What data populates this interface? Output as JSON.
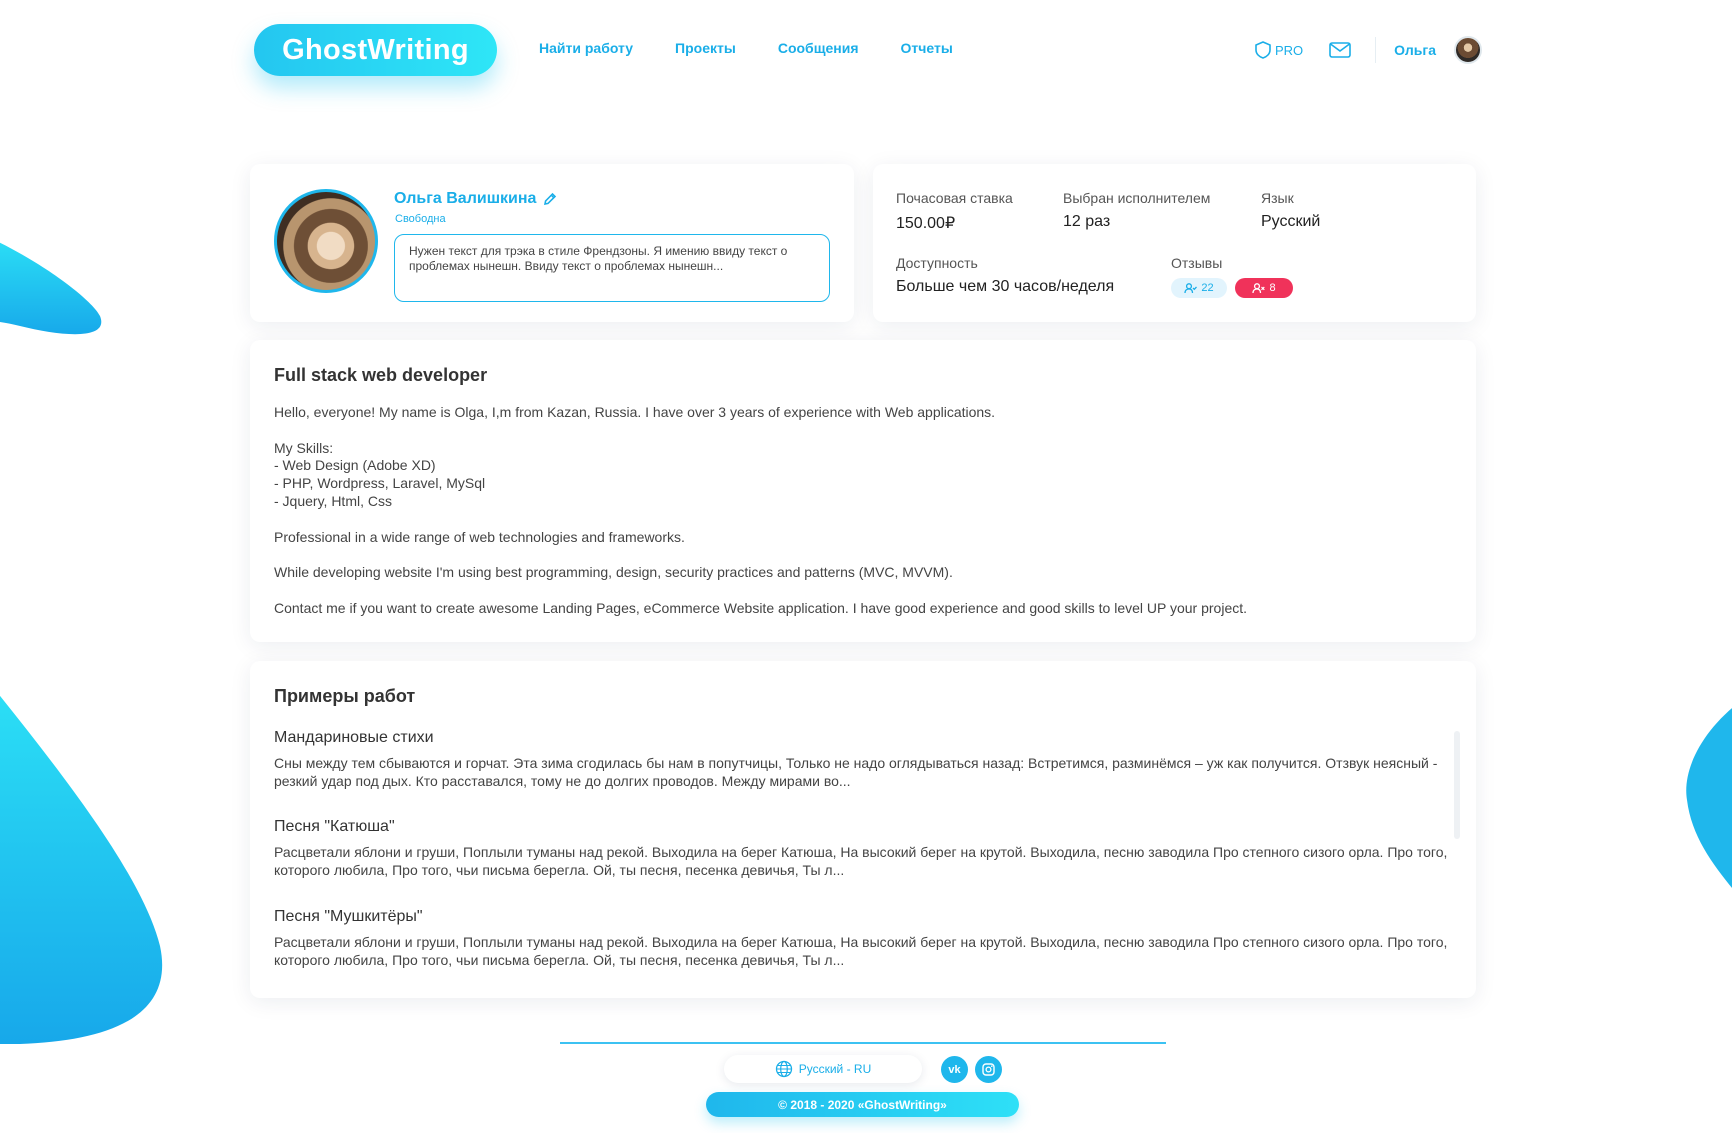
{
  "brand": {
    "logo_text": "GhostWriting"
  },
  "nav": {
    "items": [
      "Найти работу",
      "Проекты",
      "Сообщения",
      "Отчеты"
    ]
  },
  "header": {
    "pro_label": "PRO",
    "user_name": "Ольга"
  },
  "profile": {
    "name": "Ольга Валишкина",
    "status": "Свободна",
    "request_text": "Нужен текст для трэка в стиле Френдзоны. Я имению ввиду текст о проблемах нынешн. Ввиду текст о проблемах нынешн..."
  },
  "stats": {
    "hourly_rate_label": "Почасовая ставка",
    "hourly_rate_value": "150.00₽",
    "selected_label": "Выбран исполнителем",
    "selected_value": "12 раз",
    "language_label": "Язык",
    "language_value": "Русский",
    "availability_label": "Доступность",
    "availability_value": "Больше чем 30 часов/неделя",
    "reviews_label": "Отзывы",
    "reviews_positive": "22",
    "reviews_negative": "8"
  },
  "about": {
    "title": "Full stack web developer",
    "paragraphs": [
      "Hello, everyone! My name is Olga, I,m from Kazan, Russia. I have over 3 years of experience with Web applications.",
      "My Skills:\n- Web Design (Adobe XD)\n- PHP, Wordpress, Laravel, MySql\n- Jquery, Html, Css",
      "Professional in a wide range of web technologies and frameworks.",
      "While developing website I'm using best programming, design, security practices and patterns (MVC, MVVM).",
      "Contact me if you want to create awesome Landing Pages, eCommerce Website application. I have good experience and good skills to level UP your project."
    ]
  },
  "works": {
    "title": "Примеры работ",
    "items": [
      {
        "title": "Мандариновые стихи",
        "text": "Сны между тем сбываются и горчат. Эта зима сгодилась бы нам в попутчицы, Только не надо оглядываться назад: Встретимся, разминёмся – уж как получится. Отзвук неясный - резкий удар под дых. Кто расставался, тому не до долгих проводов. Между мирами во..."
      },
      {
        "title": "Песня \"Катюша\"",
        "text": "Расцветали яблони и груши, Поплыли туманы над рекой. Выходила на берег Катюша, На высокий берег на крутой. Выходила, песню заводила Про степного сизого орла. Про того, которого любила, Про того, чьи письма берегла. Ой, ты песня, песенка девичья, Ты л..."
      },
      {
        "title": "Песня \"Мушкитёры\"",
        "text": "Расцветали яблони и груши, Поплыли туманы над рекой. Выходила на берег Катюша, На высокий берег на крутой. Выходила, песню заводила Про степного сизого орла. Про того, которого любила, Про того, чьи письма берегла. Ой, ты песня, песенка девичья, Ты л..."
      }
    ]
  },
  "footer": {
    "language": "Русский - RU",
    "copyright": "© 2018 - 2020 «GhostWriting»"
  },
  "colors": {
    "accent": "#1aaee8",
    "negative": "#f0325a",
    "gradient_end": "#2ee6f7"
  }
}
